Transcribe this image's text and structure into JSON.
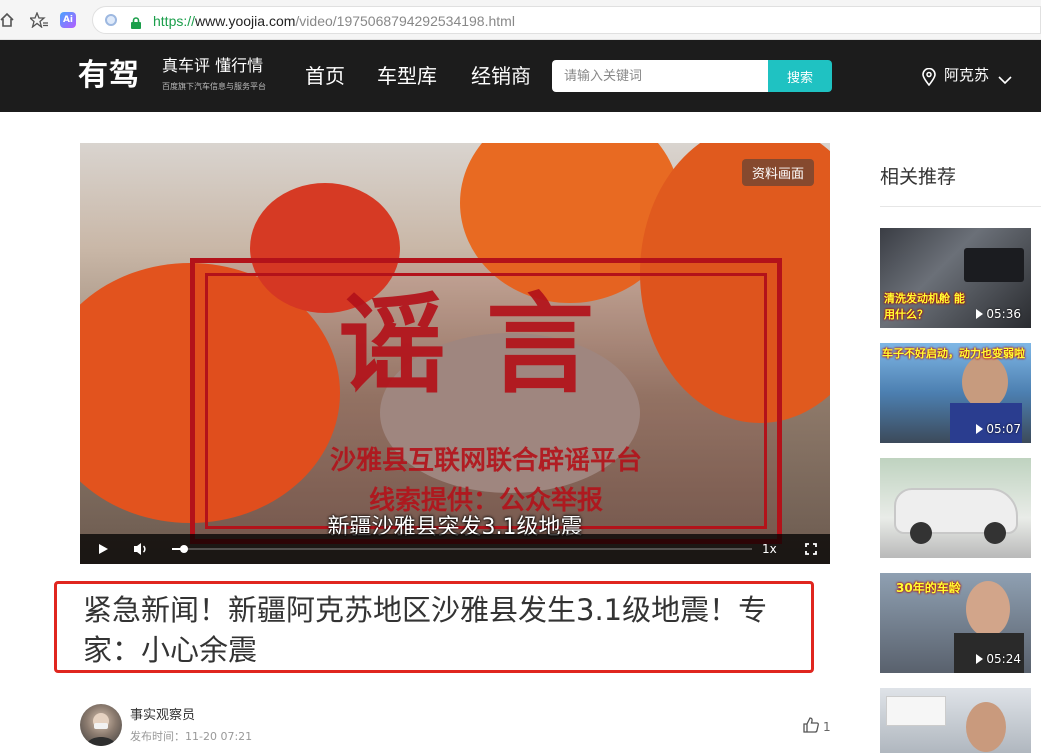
{
  "browser": {
    "url_scheme": "https://",
    "url_host": "www.yoojia.com",
    "url_path": "/video/1975068794292534198.html",
    "ai_label": "Ai"
  },
  "header": {
    "logo": "有驾",
    "slogan": "真车评 懂行情",
    "subslogan": "百度旗下汽车信息与服务平台",
    "nav": [
      "首页",
      "车型库",
      "经销商"
    ],
    "search_placeholder": "请输入关键词",
    "search_button": "搜索",
    "location": "阿克苏"
  },
  "video": {
    "source_badge": "资料画面",
    "stamp_main": "谣言",
    "stamp_line1": "沙雅县互联网联合辟谣平台",
    "stamp_line2": "线索提供：公众举报",
    "subtitle": "新疆沙雅县突发3.1级地震",
    "speed_label": "1x",
    "progress": 0.02
  },
  "article": {
    "title": "紧急新闻！新疆阿克苏地区沙雅县发生3.1级地震！专家：小心余震",
    "author": "事实观察员",
    "publish_time": "发布时间：11-20 07:21",
    "likes": "1"
  },
  "sidebar": {
    "title": "相关推荐",
    "items": [
      {
        "duration": "05:36",
        "caption": "清洗发动机舱 能用什么？"
      },
      {
        "duration": "05:07",
        "caption": "车子不好启动，动力也变弱啦"
      },
      {
        "duration": "",
        "caption": ""
      },
      {
        "duration": "05:24",
        "caption": "30年的车龄"
      },
      {
        "duration": "",
        "caption": ""
      }
    ]
  },
  "colors": {
    "header_bg": "#1c1c1c",
    "search_button": "#1fc2c2",
    "stamp_red": "#b3121a",
    "highlight_border": "#e0261f"
  }
}
